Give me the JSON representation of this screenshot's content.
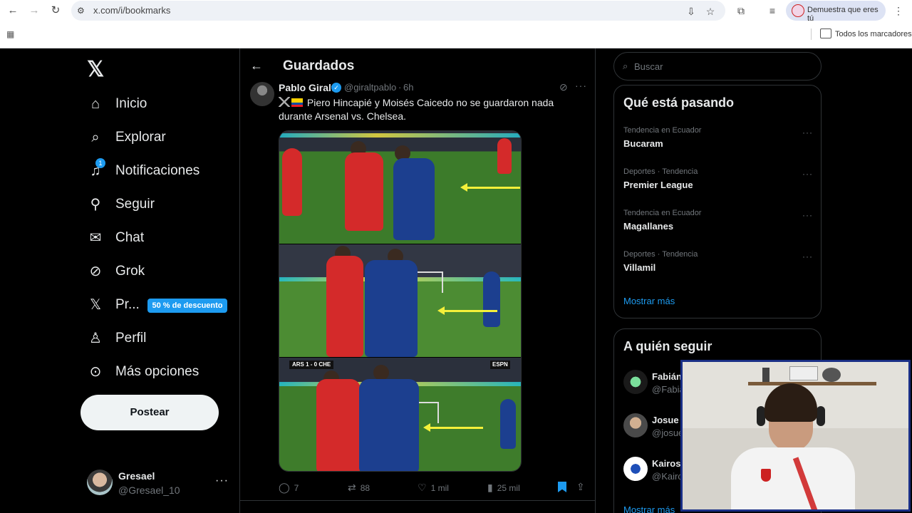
{
  "browser": {
    "url": "x.com/i/bookmarks",
    "profile_chip": "Demuestra que eres tú",
    "bookmarks_all": "Todos los marcadores"
  },
  "nav": {
    "items": [
      {
        "label": "Inicio",
        "icon": "home-icon"
      },
      {
        "label": "Explorar",
        "icon": "search-icon"
      },
      {
        "label": "Notificaciones",
        "icon": "bell-icon",
        "badge": "1"
      },
      {
        "label": "Seguir",
        "icon": "follow-icon"
      },
      {
        "label": "Chat",
        "icon": "mail-icon"
      },
      {
        "label": "Grok",
        "icon": "grok-icon"
      },
      {
        "label": "Pr...",
        "icon": "x-premium-icon",
        "promo": "50 % de descuento"
      },
      {
        "label": "Perfil",
        "icon": "profile-icon"
      },
      {
        "label": "Más opciones",
        "icon": "more-circle-icon"
      }
    ],
    "post_button": "Postear",
    "account": {
      "name": "Gresael",
      "handle": "@Gresael_10"
    }
  },
  "header": {
    "title": "Guardados"
  },
  "tweet": {
    "author": "Pablo Giralt",
    "handle": "@giraltpablo",
    "separator": "·",
    "time": "6h",
    "text": "Piero Hincapié y Moisés Caicedo no se guardaron nada durante Arsenal vs. Chelsea.",
    "scorebug": "ARS 1 - 0 CHE",
    "broadcaster": "ESPN",
    "stats": {
      "replies": "7",
      "reposts": "88",
      "likes": "1 mil",
      "views": "25 mil"
    }
  },
  "search": {
    "placeholder": "Buscar"
  },
  "trends": {
    "title": "Qué está pasando",
    "items": [
      {
        "meta": "Tendencia en Ecuador",
        "topic": "Bucaram"
      },
      {
        "meta": "Deportes · Tendencia",
        "topic": "Premier League"
      },
      {
        "meta": "Tendencia en Ecuador",
        "topic": "Magallanes"
      },
      {
        "meta": "Deportes · Tendencia",
        "topic": "Villamil"
      }
    ],
    "show_more": "Mostrar más"
  },
  "who_to_follow": {
    "title": "A quién seguir",
    "items": [
      {
        "name": "Fabián",
        "handle": "@Fabia"
      },
      {
        "name": "Josue",
        "handle": "@josue"
      },
      {
        "name": "Kairos",
        "handle": "@Kairc"
      }
    ],
    "show_more": "Mostrar más"
  },
  "colors": {
    "accent": "#1d9bf0",
    "background": "#000000",
    "border": "#2f3336"
  }
}
